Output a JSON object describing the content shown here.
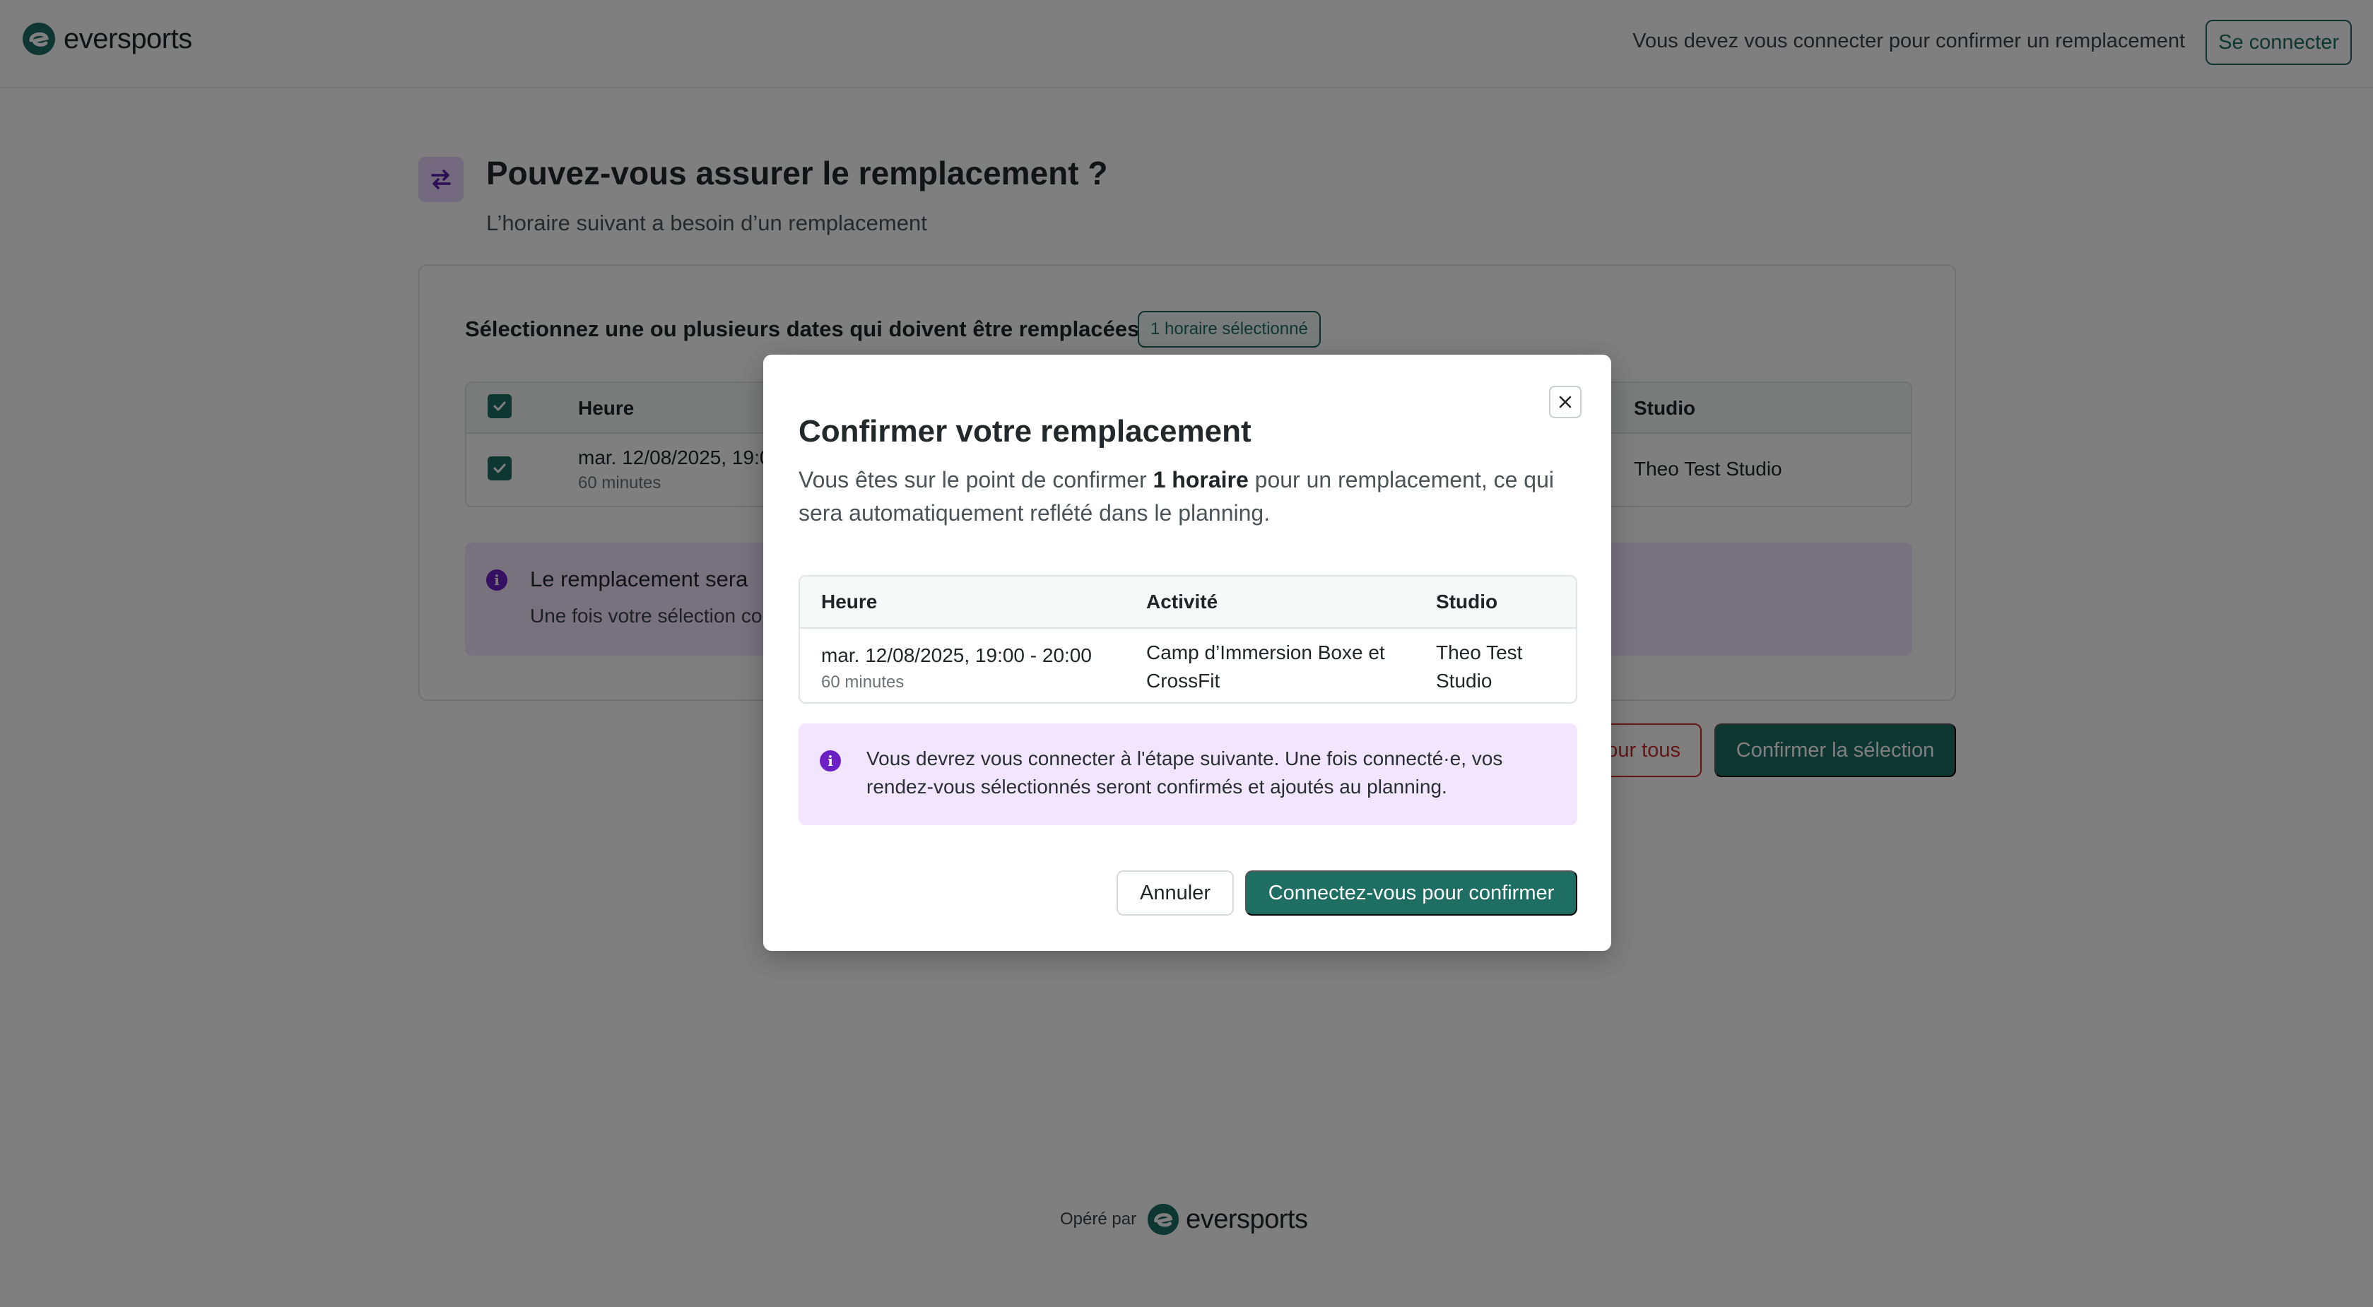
{
  "brand": {
    "name": "eversports",
    "accent": "#1f6e64",
    "purple": "#6b1fc4"
  },
  "header": {
    "message": "Vous devez vous connecter pour confirmer un remplacement",
    "login_label": "Se connecter"
  },
  "page": {
    "title": "Pouvez-vous assurer le remplacement ?",
    "subtitle": "L’horaire suivant a besoin d’un remplacement",
    "icon": "swap-arrows-icon"
  },
  "card": {
    "heading": "Sélectionnez une ou plusieurs dates qui doivent être remplacées",
    "selected_badge": "1 horaire sélectionné",
    "table": {
      "headers": {
        "time": "Heure",
        "studio": "Studio"
      },
      "row": {
        "time": "mar. 12/08/2025, 19:0",
        "duration": "60 minutes",
        "studio": "Theo Test Studio"
      }
    },
    "info": {
      "title": "Le remplacement sera",
      "text": "Une fois votre sélection co"
    }
  },
  "actions": {
    "decline_label": "our tous",
    "confirm_label": "Confirmer la sélection"
  },
  "footer": {
    "label": "Opéré par",
    "brand": "eversports"
  },
  "modal": {
    "title": "Confirmer votre remplacement",
    "desc_before": "Vous êtes sur le point de confirmer ",
    "desc_bold": "1 horaire",
    "desc_after": " pour un remplacement, ce qui sera automatiquement reflété dans le planning.",
    "table": {
      "headers": {
        "time": "Heure",
        "activity": "Activité",
        "studio": "Studio"
      },
      "row": {
        "time": "mar. 12/08/2025, 19:00 - 20:00",
        "duration": "60 minutes",
        "activity_line1": "Camp d’Immersion Boxe et",
        "activity_line2": "CrossFit",
        "studio_line1": "Theo Test",
        "studio_line2": "Studio"
      }
    },
    "info_text": "Vous devrez vous connecter à l'étape suivante. Une fois connecté·e, vos rendez-vous sélectionnés seront confirmés et ajoutés au planning.",
    "cancel_label": "Annuler",
    "login_confirm_label": "Connectez-vous pour confirmer"
  }
}
